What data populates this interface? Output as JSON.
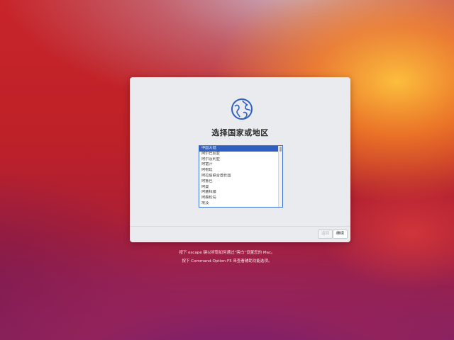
{
  "dialog": {
    "title": "选择国家或地区",
    "globe_icon": "globe-icon",
    "countries": [
      "中国大陆",
      "阿尔巴尼亚",
      "阿尔及利亚",
      "阿富汗",
      "阿根廷",
      "阿拉伯联合酋长国",
      "阿鲁巴",
      "阿曼",
      "阿塞拜疆",
      "阿森松岛",
      "埃及"
    ],
    "selected": "中国大陆",
    "back_label": "返回",
    "continue_label": "继续"
  },
  "hints": {
    "line1": "按下 escape 键以听取如何通过“旁白”设置您的 Mac。",
    "line2": "按下 Command-Option-F5 来查看辅助功能选项。"
  },
  "colors": {
    "accent": "#2f5fbf",
    "dialog_bg": "#e9ebee"
  }
}
